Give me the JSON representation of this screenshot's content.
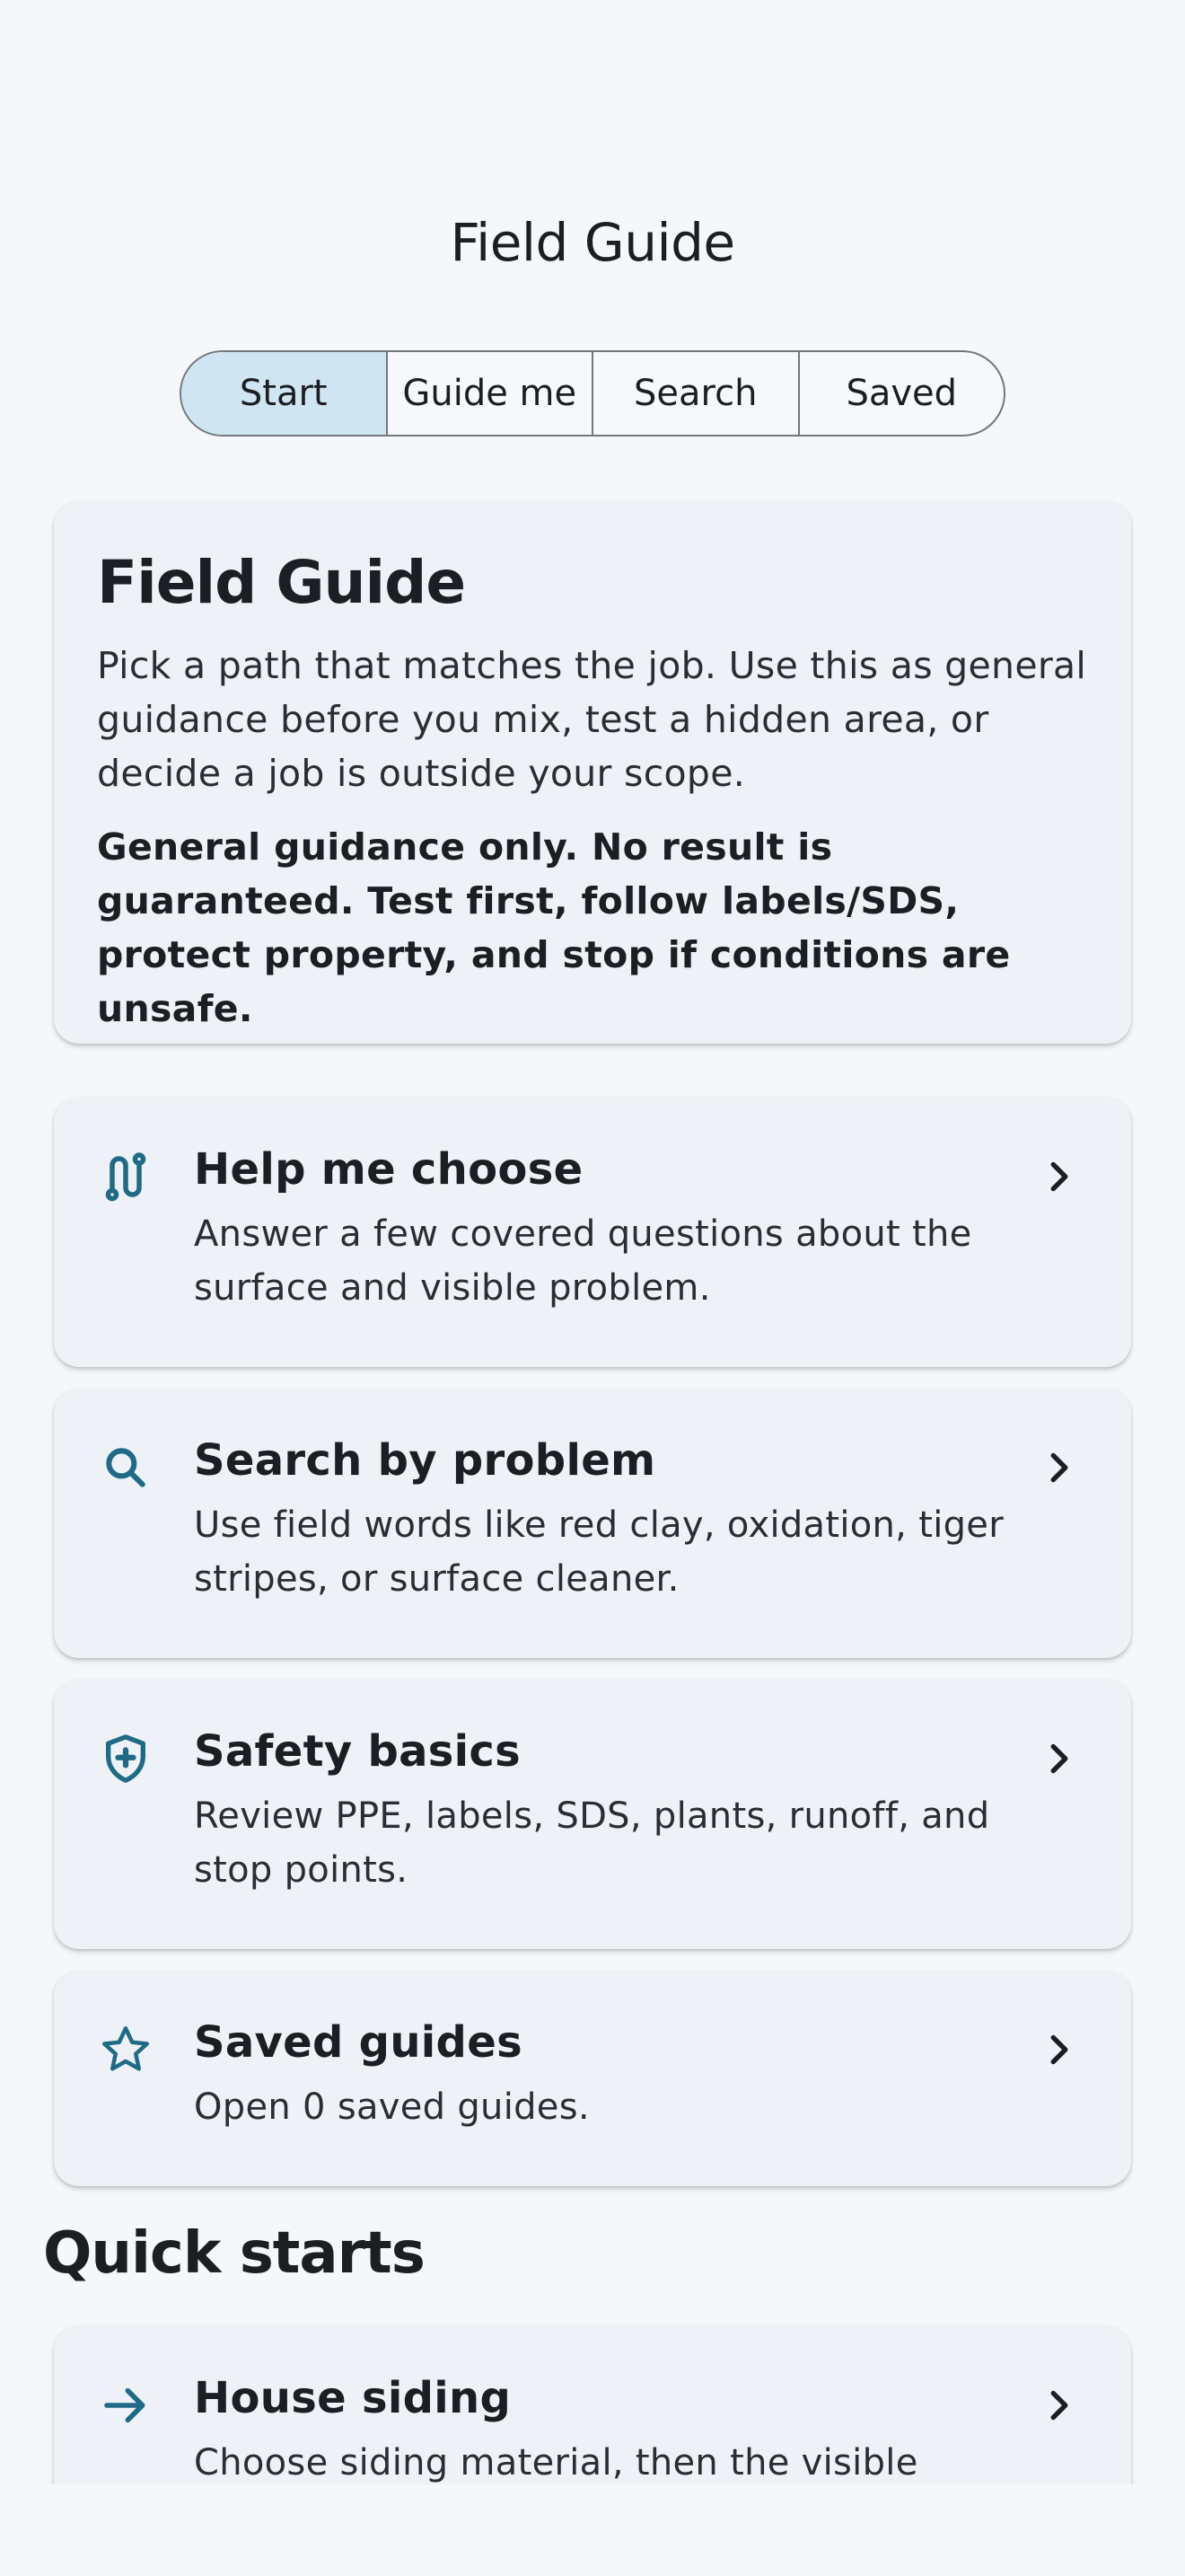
{
  "header": {
    "title": "Field Guide"
  },
  "tabs": [
    {
      "label": "Start",
      "active": true
    },
    {
      "label": "Guide me",
      "active": false
    },
    {
      "label": "Search",
      "active": false
    },
    {
      "label": "Saved",
      "active": false
    }
  ],
  "intro": {
    "title": "Field Guide",
    "body": "Pick a path that matches the job. Use this as general guidance before you mix, test a hidden area, or decide a job is outside your scope.",
    "warning": "General guidance only. No result is guaranteed. Test first, follow labels/SDS, protect property, and stop if conditions are unsafe."
  },
  "nav_cards": [
    {
      "icon": "route-icon",
      "title": "Help me choose",
      "desc": "Answer a few covered questions about the surface and visible problem."
    },
    {
      "icon": "search-icon",
      "title": "Search by problem",
      "desc": "Use field words like red clay, oxidation, tiger stripes, or surface cleaner."
    },
    {
      "icon": "shield-plus-icon",
      "title": "Safety basics",
      "desc": "Review PPE, labels, SDS, plants, runoff, and stop points."
    },
    {
      "icon": "star-icon",
      "title": "Saved guides",
      "desc": "Open 0 saved guides."
    }
  ],
  "quick_starts": {
    "title": "Quick starts",
    "items": [
      {
        "icon": "arrow-right-icon",
        "title": "House siding",
        "desc": "Choose siding material, then the visible"
      }
    ]
  },
  "colors": {
    "accent": "#1f6b86",
    "active_tab": "#cfe5f2",
    "card": "#eef2f6",
    "background": "#f5f7fb"
  }
}
